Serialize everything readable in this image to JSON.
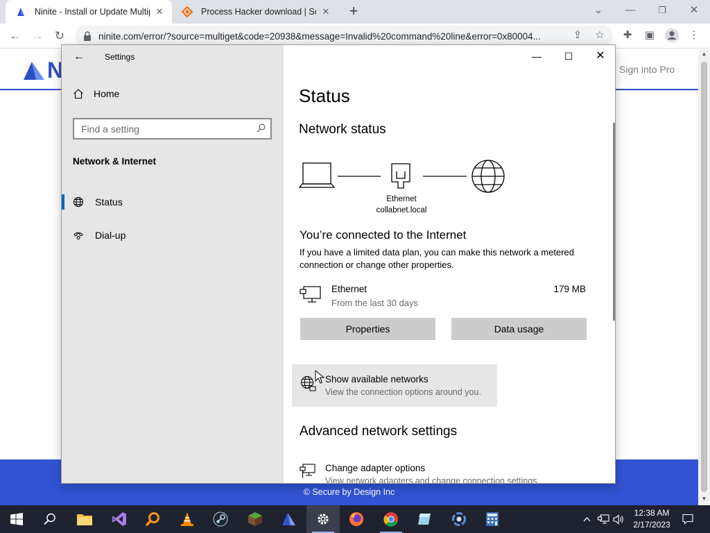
{
  "browser": {
    "tabs": [
      {
        "title": "Ninite - Install or Update Multiple Apps at Once",
        "active": true
      },
      {
        "title": "Process Hacker download | SourceForge.net",
        "active": false
      }
    ],
    "url": "ninite.com/error/?source=multiget&code=20938&message=Invalid%20command%20line&error=0x80004..."
  },
  "page": {
    "logo_letter": "N",
    "signin": "Sign into Pro",
    "footer": "© Secure by Design Inc"
  },
  "settings": {
    "window_title": "Settings",
    "home_label": "Home",
    "search_placeholder": "Find a setting",
    "section": "Network & Internet",
    "nav": [
      {
        "label": "Status",
        "selected": true
      },
      {
        "label": "Dial-up",
        "selected": false
      }
    ],
    "heading": "Status",
    "network_status_heading": "Network status",
    "diagram_label_1": "Ethernet",
    "diagram_label_2": "collabnet.local",
    "connected_title": "You’re connected to the Internet",
    "connected_text": "If you have a limited data plan, you can make this network a metered connection or change other properties.",
    "connection": {
      "name": "Ethernet",
      "subtitle": "From the last 30 days",
      "usage": "179 MB"
    },
    "properties_button": "Properties",
    "data_usage_button": "Data usage",
    "show_networks_title": "Show available networks",
    "show_networks_subtitle": "View the connection options around you.",
    "advanced_heading": "Advanced network settings",
    "adapter_title": "Change adapter options",
    "adapter_subtitle": "View network adapters and change connection settings."
  },
  "taskbar": {
    "time": "12:38 AM",
    "date": "2/17/2023"
  },
  "colors": {
    "accent": "#0067c0",
    "ninite_blue": "#3253d3",
    "taskbar": "#1f2330"
  }
}
